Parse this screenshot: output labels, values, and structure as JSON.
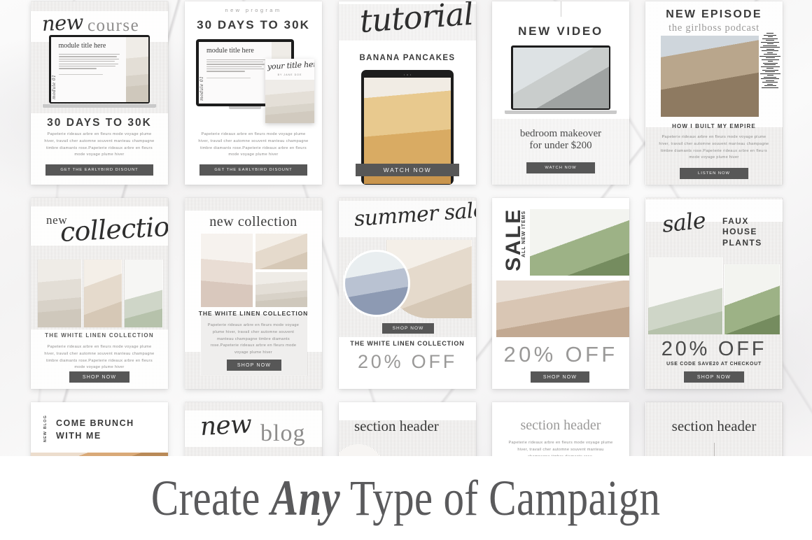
{
  "banner": {
    "title_part1": "Create ",
    "title_emphasis": "Any",
    "title_part2": " Type of Campaign"
  },
  "cards": {
    "new_course": {
      "eyebrow_script": "new",
      "eyebrow_serif": "course",
      "slide_side_label": "module 01",
      "slide_title": "module title here",
      "headline": "30 DAYS TO 30K",
      "body": "Papeterie rideaux arbre en fleurs mode voyage plume hiver, travail cher automne souvent manteau champagne timbre diamants rose.Papeterie rideaux arbre en fleurs mode voyage plume hiver",
      "button": "GET THE EARLYBIRD DISOUNT"
    },
    "new_program": {
      "eyebrow": "new program",
      "headline": "30 DAYS TO 30K",
      "slide_side_label": "module 01",
      "slide_title": "module title here",
      "cover_script": "your title here",
      "cover_sub": "BY JANE DOE",
      "body": "Papeterie rideaux arbre en fleurs mode voyage plume hiver, travail cher automne souvent manteau champagne timbre diamants rose.Papeterie rideaux arbre en fleurs mode voyage plume hiver",
      "button": "GET THE EARLYBIRD DISOUNT"
    },
    "tutorial": {
      "script": "tutorial",
      "subtitle": "BANANA PANCAKES",
      "button": "WATCH NOW"
    },
    "new_video": {
      "headline": "NEW VIDEO",
      "caption_line1": "bedroom makeover",
      "caption_line2": "for under $200",
      "button": "WATCH NOW"
    },
    "new_episode": {
      "headline": "NEW EPISODE",
      "subtitle": "the girlboss podcast",
      "episode_title": "HOW I BUILT MY EMPIRE",
      "body": "Papeterie rideaux arbre en fleurs mode voyage plume hiver, travail cher automne souvent manteau champagne timbre diamants rose.Papeterie rideaux arbre en fleurs mode voyage plume hiver",
      "button": "LISTEN NOW"
    },
    "new_collection_a": {
      "eyebrow_serif": "new",
      "eyebrow_script": "collection",
      "subtitle": "THE WHITE LINEN COLLECTION",
      "body": "Papeterie rideaux arbre en fleurs mode voyage plume hiver, travail cher automne souvent manteau champagne timbre diamants rose.Papeterie rideaux arbre en fleurs mode voyage plume hiver",
      "button": "SHOP NOW"
    },
    "new_collection_b": {
      "title": "new collection",
      "subtitle": "THE WHITE LINEN COLLECTION",
      "body": "Papeterie rideaux arbre en fleurs mode voyage plume hiver, travail cher automne souvent manteau champagne timbre diamants rose.Papeterie rideaux arbre en fleurs mode voyage plume hiver",
      "button": "SHOP NOW"
    },
    "summer_sale": {
      "script": "summer sale",
      "button": "SHOP NOW",
      "subtitle": "THE WHITE LINEN COLLECTION",
      "discount": "20% OFF"
    },
    "sale_items": {
      "title": "SALE",
      "subtitle": "ALL NEW ITEMS",
      "discount": "20% OFF",
      "button": "SHOP NOW"
    },
    "faux_plants": {
      "script": "sale",
      "title_line1": "FAUX",
      "title_line2": "HOUSE",
      "title_line3": "PLANTS",
      "discount": "20% OFF",
      "code_text": "USE CODE SAVE20 AT CHECKOUT",
      "button": "SHOP NOW"
    },
    "come_brunch": {
      "side_label": "NEW BLOG",
      "title_line1": "COME BRUNCH",
      "title_line2": "WITH ME"
    },
    "new_blog": {
      "script": "new",
      "serif": "blog"
    },
    "section_header_a": {
      "title": "section header"
    },
    "section_header_b": {
      "title": "section header",
      "body": "Papeterie rideaux arbre en fleurs mode voyage plume hiver, travail cher automne souvent manteau champagne timbre diamants rose."
    },
    "section_header_c": {
      "title": "section header"
    }
  },
  "colors": {
    "button_bg": "#575757",
    "button_text": "#f4f4f4",
    "heading_dark": "#3a3a3a",
    "body_gray": "#8d8c8b",
    "discount_gray": "#9a9998",
    "banner_text": "#5a5a5c",
    "card_bg": "#ffffff",
    "page_bg": "#f3f2f1"
  }
}
